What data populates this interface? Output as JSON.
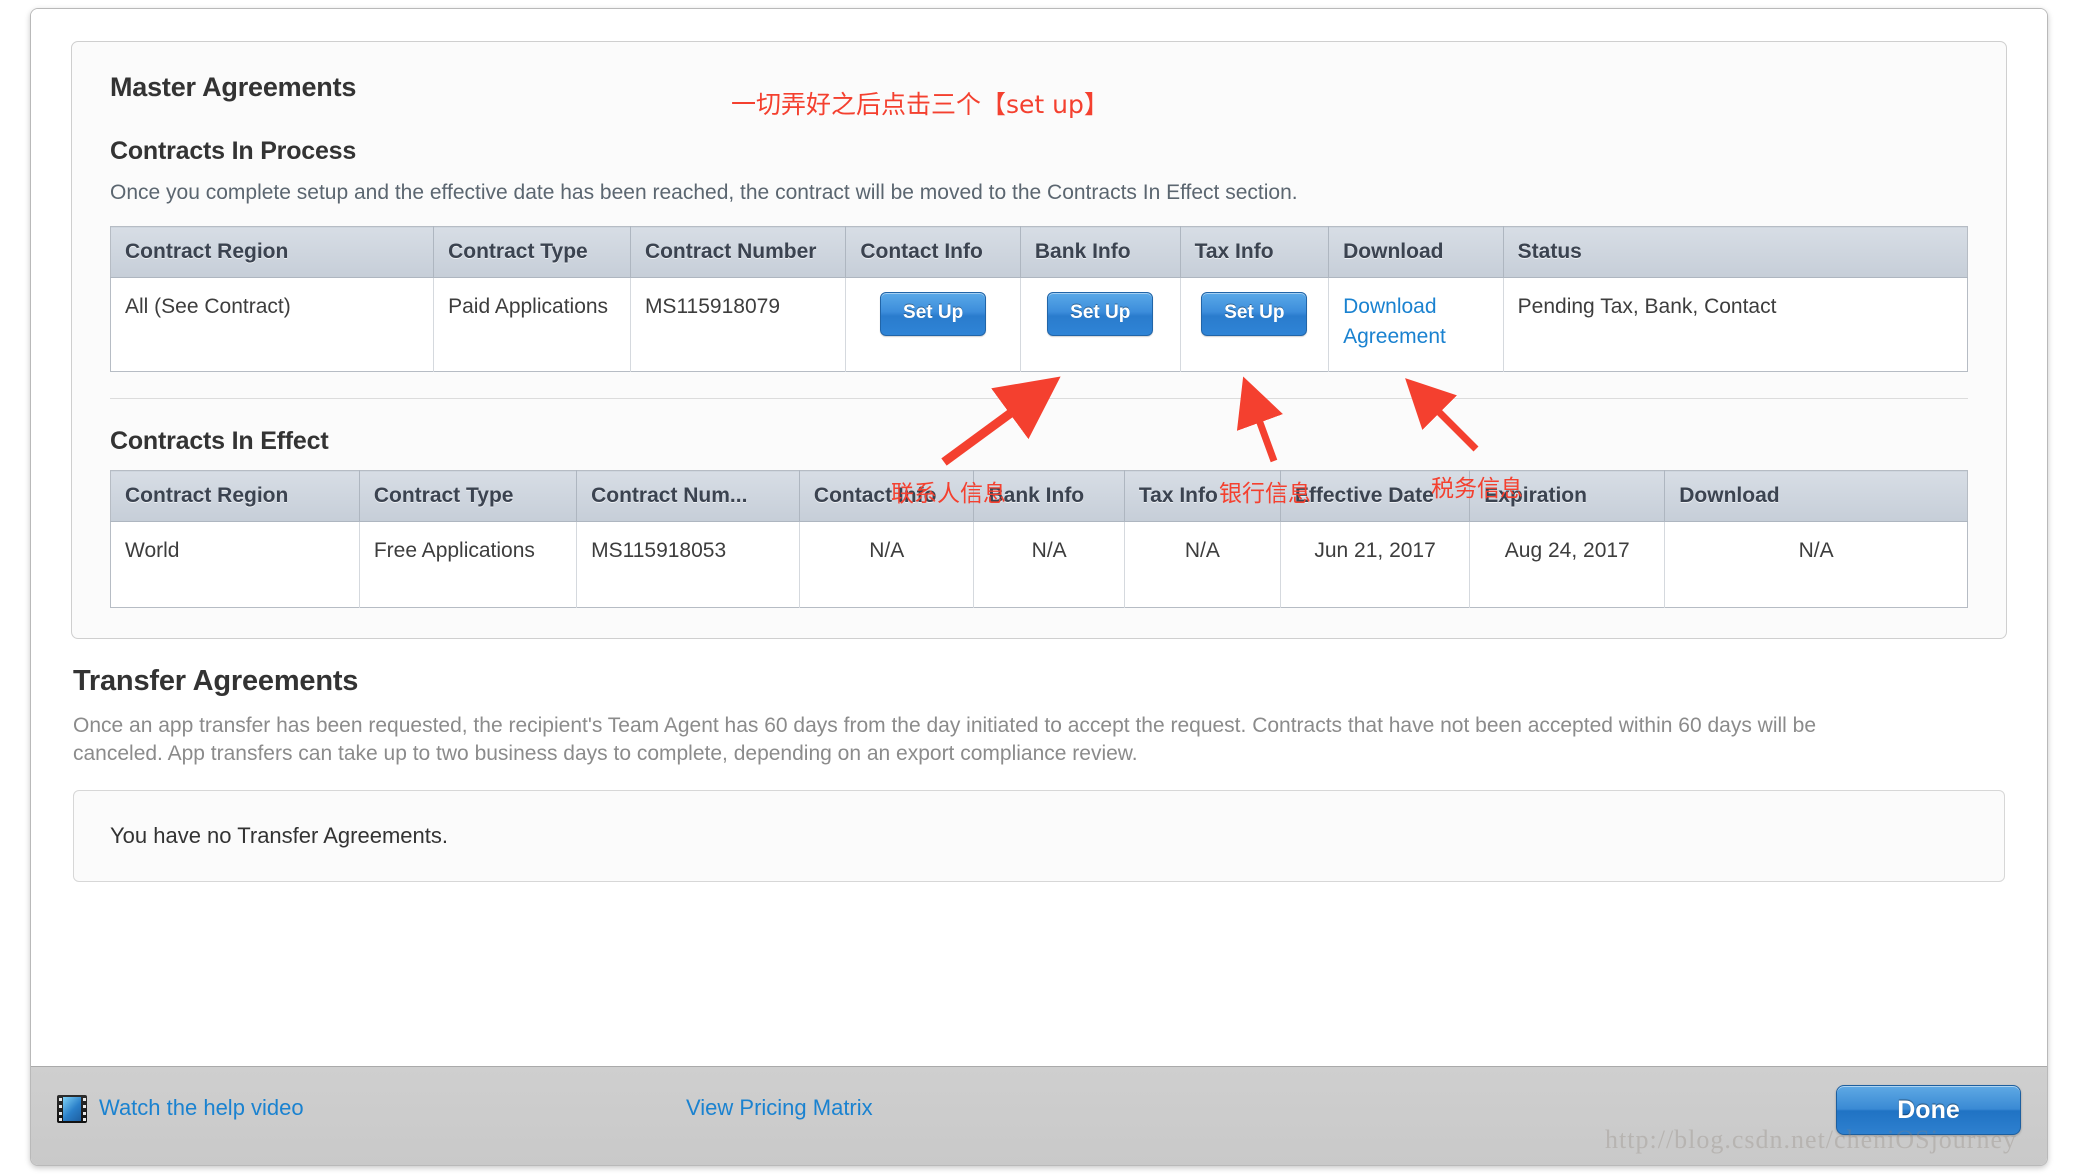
{
  "page": {
    "section_title": "Master Agreements",
    "watermark": "http://blog.csdn.net/cheniOSjourney"
  },
  "contracts_in_process": {
    "heading": "Contracts In Process",
    "description": "Once you complete setup and the effective date has been reached, the contract will be moved to the Contracts In Effect section.",
    "columns": [
      "Contract Region",
      "Contract Type",
      "Contract Number",
      "Contact Info",
      "Bank Info",
      "Tax Info",
      "Download",
      "Status"
    ],
    "row": {
      "region": "All (See Contract)",
      "type": "Paid Applications",
      "number": "MS115918079",
      "contact_button": "Set Up",
      "bank_button": "Set Up",
      "tax_button": "Set Up",
      "download_link": "Download Agreement",
      "status": "Pending Tax, Bank, Contact"
    }
  },
  "contracts_in_effect": {
    "heading": "Contracts In Effect",
    "columns": [
      "Contract Region",
      "Contract Type",
      "Contract Num...",
      "Contact Info",
      "Bank Info",
      "Tax Info",
      "Effective Date",
      "Expiration",
      "Download"
    ],
    "row": {
      "region": "World",
      "type": "Free Applications",
      "number": "MS115918053",
      "contact": "N/A",
      "bank": "N/A",
      "tax": "N/A",
      "effective_date": "Jun 21, 2017",
      "expiration": "Aug 24, 2017",
      "download": "N/A"
    }
  },
  "transfer_agreements": {
    "heading": "Transfer Agreements",
    "description": "Once an app transfer has been requested, the recipient's Team Agent has 60 days from the day initiated to accept the request. Contracts that have not been accepted within 60 days will be canceled. App transfers can take up to two business days to complete, depending on an export compliance review.",
    "empty_message": "You have no Transfer Agreements."
  },
  "footer": {
    "help_video_link": "Watch the help video",
    "pricing_matrix_link": "View Pricing Matrix",
    "done_button": "Done"
  },
  "annotations": {
    "top": "一切弄好之后点击三个【set up】",
    "contact": "联系人信息",
    "bank": "银行信息",
    "tax": "税务信息",
    "color": "#f4402f"
  }
}
